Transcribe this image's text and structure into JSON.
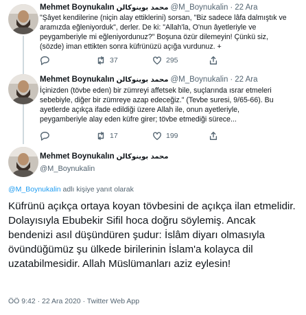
{
  "tweets": [
    {
      "name": "Mehmet Boynukalın",
      "arabic_name": "محمد بوينوكالن",
      "handle": "@M_Boynukalin",
      "time": "22 Ara",
      "text": "\"Şâyet kendilerine (niçin alay ettiklerini) sorsan, \"Biz sadece lâfa dalmıştık ve\naramızda eğleniyorduk\", derler. De ki: \"Allah'la, O'nun âyetleriyle ve\npeygamberiyle mi eğleniyordunuz?\" Boşuna özür dilemeyin! Çünkü siz,\n(sözde) iman ettikten sonra küfrünüzü açığa vurdunuz. +",
      "retweets": "37",
      "likes": "295"
    },
    {
      "name": "Mehmet Boynukalın",
      "arabic_name": "محمد بوينوكالن",
      "handle": "@M_Boynukalin",
      "time": "22 Ara",
      "text": "İçinizden (tövbe eden) bir zümreyi affetsek bile, suçlarında ısrar etmeleri\nsebebiyle, diğer bir zümreye azap edeceğiz.\" (Tevbe suresi, 9/65-66). Bu\nayetlerde açıkça ifade edildiği üzere Allah ile, onun ayetleriyle,\npeygamberiyle alay eden küfre girer; tövbe etmediği sürece...",
      "retweets": "17",
      "likes": "199"
    }
  ],
  "main": {
    "name": "Mehmet Boynukalın",
    "arabic_name": "محمد بوينوكالن",
    "handle": "@M_Boynukalin",
    "reply_handle": "@M_Boynukalin",
    "reply_suffix": " adlı kişiye yanıt olarak",
    "text": "Küfrünü açıkça ortaya koyan tövbesini de açıkça ilan etmelidir. Dolayısıyla Ebubekir Sifil hoca doğru söylemiş. Ancak bendenizi asıl düşündüren şudur: İslâm diyarı olmasıyla övündüğümüz şu ülkede birilerinin İslam'a kolayca dil uzatabilmesidir. Allah Müslümanları aziz eylesin!",
    "meta": "ÖÖ 9:42 · 22 Ara 2020 · Twitter Web App"
  },
  "separator": "·"
}
